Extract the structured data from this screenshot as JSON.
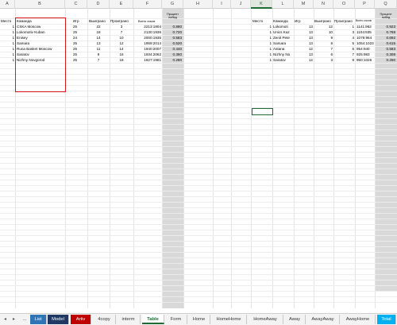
{
  "columns": [
    "A",
    "B",
    "C",
    "D",
    "E",
    "F",
    "G",
    "H",
    "I",
    "J",
    "K",
    "L",
    "M",
    "N",
    "O",
    "P",
    "Q"
  ],
  "left_table": {
    "headers": {
      "place": "Место",
      "team": "Команда",
      "games": "Игр",
      "won": "Выиграно",
      "lost": "Проиграно",
      "points": "Всего очков",
      "pct": "Процент побед"
    },
    "rows": [
      {
        "place": "1",
        "team": "CSKA Moscow",
        "games": "25",
        "won": "22",
        "lost": "3",
        "points": "2213:1904",
        "pct": "0.880"
      },
      {
        "place": "1",
        "team": "Lokomotiv Kuban",
        "games": "25",
        "won": "18",
        "lost": "7",
        "points": "2130:1936",
        "pct": "0.720"
      },
      {
        "place": "1",
        "team": "Enisey",
        "games": "24",
        "won": "14",
        "lost": "10",
        "points": "2000:1935",
        "pct": "0.583"
      },
      {
        "place": "1",
        "team": "Samara",
        "games": "25",
        "won": "13",
        "lost": "12",
        "points": "1959:2014",
        "pct": "0.520"
      },
      {
        "place": "1",
        "team": "Runa Basket Moscow",
        "games": "25",
        "won": "11",
        "lost": "14",
        "points": "1940:2007",
        "pct": "0.440"
      },
      {
        "place": "1",
        "team": "Saratov",
        "games": "25",
        "won": "9",
        "lost": "16",
        "points": "1934:2062",
        "pct": "0.360"
      },
      {
        "place": "1",
        "team": "Nizhny Novgorod",
        "games": "25",
        "won": "7",
        "lost": "18",
        "points": "1827:1981",
        "pct": "0.280"
      }
    ]
  },
  "right_table": {
    "headers": {
      "place": "Место",
      "team": "Команда",
      "games": "Игр",
      "won": "Выиграно",
      "lost": "Проиграно",
      "points": "Всего очков",
      "pct": "Процент побед"
    },
    "rows": [
      {
        "place": "1",
        "team": "Lokomoti",
        "games": "13",
        "won": "12",
        "lost": "1",
        "points": "1141:962",
        "pct": "0.923"
      },
      {
        "place": "1",
        "team": "Unics Kaz",
        "games": "13",
        "won": "10",
        "lost": "3",
        "points": "1104:935",
        "pct": "0.769"
      },
      {
        "place": "1",
        "team": "Zenit Pete",
        "games": "13",
        "won": "9",
        "lost": "4",
        "points": "1079:964",
        "pct": "0.692"
      },
      {
        "place": "1",
        "team": "Samara",
        "games": "13",
        "won": "8",
        "lost": "5",
        "points": "1054:1023",
        "pct": "0.615"
      },
      {
        "place": "1",
        "team": "Astana",
        "games": "12",
        "won": "7",
        "lost": "5",
        "points": "954:940",
        "pct": "0.583"
      },
      {
        "place": "1",
        "team": "Nizhny No",
        "games": "13",
        "won": "6",
        "lost": "7",
        "points": "925:983",
        "pct": "0.308"
      },
      {
        "place": "1",
        "team": "Saratov",
        "games": "12",
        "won": "3",
        "lost": "9",
        "points": "950:1026",
        "pct": "0.250"
      }
    ]
  },
  "tabs": [
    {
      "label": "List",
      "color": "#2f75b5"
    },
    {
      "label": "Model",
      "color": "#1f3864"
    },
    {
      "label": "Artiv",
      "color": "#c00000"
    },
    {
      "label": "4copy",
      "color": ""
    },
    {
      "label": "interm",
      "color": ""
    },
    {
      "label": "Table",
      "color": "",
      "active": true
    },
    {
      "label": "Form",
      "color": ""
    },
    {
      "label": "Home",
      "color": ""
    },
    {
      "label": "HomeHome",
      "color": ""
    },
    {
      "label": "HomeAway",
      "color": ""
    },
    {
      "label": "Away",
      "color": ""
    },
    {
      "label": "AwayAway",
      "color": ""
    },
    {
      "label": "AwayHome",
      "color": ""
    },
    {
      "label": "Total",
      "color": "#00b0f0"
    }
  ],
  "nav": {
    "prev": "◂",
    "next": "▸",
    "more": "..."
  },
  "colors": {
    "highlight_box": "#e0161b",
    "selected_column": "#1e6b34",
    "gray_fill": "#d9d9d9"
  }
}
